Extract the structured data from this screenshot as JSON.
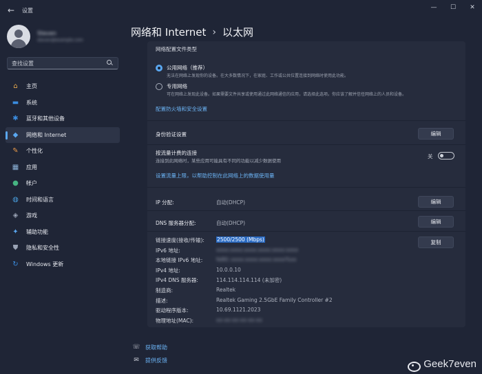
{
  "titlebar": {
    "app_title": "设置",
    "back_glyph": "←",
    "minimize_glyph": "—",
    "maximize_glyph": "☐",
    "close_glyph": "✕"
  },
  "profile": {
    "name": "Steven",
    "email": "steven@example.com"
  },
  "search": {
    "placeholder": "查找设置"
  },
  "sidebar": {
    "items": [
      {
        "label": "主页",
        "icon": "home-icon",
        "glyph": "⌂",
        "color": "#e6a84c"
      },
      {
        "label": "系统",
        "icon": "system-icon",
        "glyph": "▬",
        "color": "#3b8de0"
      },
      {
        "label": "蓝牙和其他设备",
        "icon": "bluetooth-icon",
        "glyph": "✱",
        "color": "#3b8de0"
      },
      {
        "label": "网络和 Internet",
        "icon": "wifi-icon",
        "glyph": "◆",
        "color": "#5aa7f0"
      },
      {
        "label": "个性化",
        "icon": "brush-icon",
        "glyph": "✎",
        "color": "#e89a4a"
      },
      {
        "label": "应用",
        "icon": "apps-icon",
        "glyph": "▦",
        "color": "#8db3d9"
      },
      {
        "label": "帐户",
        "icon": "account-icon",
        "glyph": "●",
        "color": "#46b482"
      },
      {
        "label": "时间和语言",
        "icon": "globe-icon",
        "glyph": "◍",
        "color": "#4aa0e0"
      },
      {
        "label": "游戏",
        "icon": "gamepad-icon",
        "glyph": "◈",
        "color": "#9aa3b5"
      },
      {
        "label": "辅助功能",
        "icon": "accessibility-icon",
        "glyph": "✦",
        "color": "#5aa7f0"
      },
      {
        "label": "隐私和安全性",
        "icon": "shield-icon",
        "glyph": "⛊",
        "color": "#9aa3b5"
      },
      {
        "label": "Windows 更新",
        "icon": "update-icon",
        "glyph": "↻",
        "color": "#3b8de0"
      }
    ]
  },
  "breadcrumb": {
    "parent": "网络和 Internet",
    "separator": "›",
    "current": "以太网"
  },
  "profile_type": {
    "heading": "网络配置文件类型",
    "public_title": "公用网络（推荐）",
    "public_desc": "无法在网络上发现你的设备。在大多数情况下，在家庭、工作或公共位置连接到网络时使用此功能。",
    "private_title": "专用网络",
    "private_desc": "可在网络上发现此设备。如果需要文件共享或使用通过此网络通信的应用，请选择此选项。你应该了解并信任网络上的人员和设备。",
    "firewall_link": "配置防火墙和安全设置"
  },
  "auth": {
    "label": "身份验证设置",
    "edit_button": "编辑"
  },
  "metered": {
    "label": "按流量计费的连接",
    "desc": "连接到此网络时，某些应用可能具有不同的功能以减少数据使用",
    "toggle_state": "关",
    "link": "设置流量上限，以帮助控制在此网络上的数据使用量"
  },
  "ip": {
    "label": "IP 分配:",
    "value": "自动(DHCP)",
    "edit_button": "编辑"
  },
  "dns": {
    "label": "DNS 服务器分配:",
    "value": "自动(DHCP)",
    "edit_button": "编辑"
  },
  "properties": {
    "copy_button": "复制",
    "items": [
      {
        "key": "链接速度(接收/传输):",
        "value": "2500/2500 (Mbps)",
        "style": "selected"
      },
      {
        "key": "IPv6 地址:",
        "value": "xxxx:xxxx:xxxx:xxxx:xxxx:xxxx",
        "style": "blur"
      },
      {
        "key": "本地链接 IPv6 地址:",
        "value": "fe80::xxxx:xxxx:xxxx:xxxx%xx",
        "style": "blur"
      },
      {
        "key": "IPv4 地址:",
        "value": "10.0.0.10",
        "style": ""
      },
      {
        "key": "IPv4 DNS 服务器:",
        "value": "114.114.114.114 (未加密)",
        "style": ""
      },
      {
        "key": "制造商:",
        "value": "Realtek",
        "style": ""
      },
      {
        "key": "描述:",
        "value": "Realtek Gaming 2.5GbE Family Controller #2",
        "style": ""
      },
      {
        "key": "驱动程序版本:",
        "value": "10.69.1121.2023",
        "style": ""
      },
      {
        "key": "物理地址(MAC):",
        "value": "xx-xx-xx-xx-xx-xx",
        "style": "blur"
      }
    ]
  },
  "footer": {
    "help": "获取帮助",
    "feedback": "提供反馈"
  },
  "watermark": {
    "text": "Geek7even"
  },
  "colors": {
    "accent": "#5aa7f0",
    "background": "#1f2536",
    "card": "#262c3d"
  }
}
